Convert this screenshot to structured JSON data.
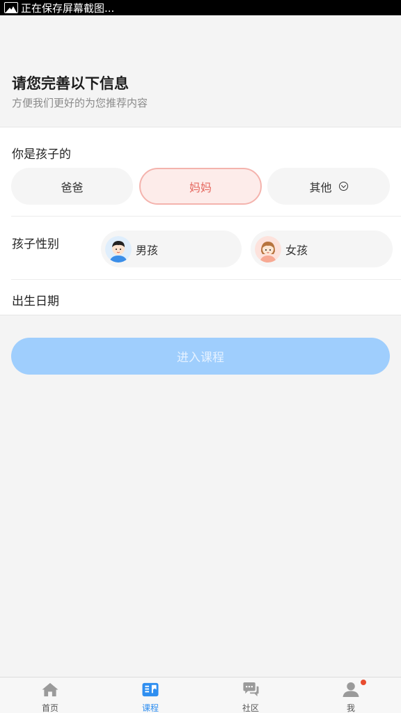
{
  "status_bar": {
    "text": "正在保存屏幕截图..."
  },
  "header": {
    "title": "请您完善以下信息",
    "subtitle": "方便我们更好的为您推荐内容"
  },
  "relation": {
    "label": "你是孩子的",
    "options": [
      {
        "label": "爸爸",
        "selected": false
      },
      {
        "label": "妈妈",
        "selected": true
      },
      {
        "label": "其他",
        "selected": false
      }
    ]
  },
  "gender": {
    "label": "孩子性别",
    "options": [
      {
        "label": "男孩",
        "icon": "boy-avatar-icon"
      },
      {
        "label": "女孩",
        "icon": "girl-avatar-icon"
      }
    ]
  },
  "birth": {
    "label": "出生日期"
  },
  "enter_button": {
    "label": "进入课程"
  },
  "colors": {
    "accent": "#2e8ef0",
    "button_disabled": "#9fcefd",
    "selected_bg": "#fdecea",
    "selected_border": "#f4b3ad",
    "selected_text": "#e5675e",
    "badge": "#e84c2f"
  },
  "tabbar": {
    "tabs": [
      {
        "label": "首页",
        "icon": "home-icon",
        "active": false
      },
      {
        "label": "课程",
        "icon": "book-icon",
        "active": true
      },
      {
        "label": "社区",
        "icon": "chat-icon",
        "active": false
      },
      {
        "label": "我",
        "icon": "user-icon",
        "active": false,
        "badge": true
      }
    ]
  }
}
